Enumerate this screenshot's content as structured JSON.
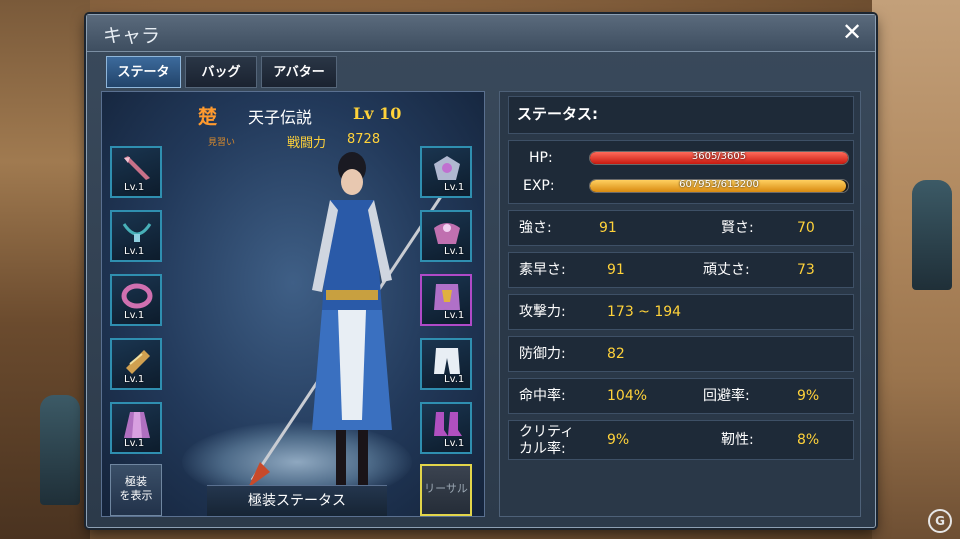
{
  "window": {
    "title": "キャラ",
    "close_label": "✕"
  },
  "tabs": [
    {
      "label": "ステータス",
      "active": true
    },
    {
      "label": "バッグ",
      "active": false
    },
    {
      "label": "アバター",
      "active": false
    }
  ],
  "character": {
    "faction": "楚",
    "name": "天子伝説",
    "level": "Lv 10",
    "subtitle": "見習い",
    "power_label": "戦闘力",
    "power_value": "8728"
  },
  "equipment": {
    "left": [
      {
        "slot": "weapon",
        "level": "Lv.1",
        "icon": "dagger-icon",
        "color": "#c87088"
      },
      {
        "slot": "necklace",
        "level": "Lv.1",
        "icon": "necklace-icon",
        "color": "#48b0b8"
      },
      {
        "slot": "ring",
        "level": "Lv.1",
        "icon": "ring-icon",
        "color": "#d070b0"
      },
      {
        "slot": "bracer",
        "level": "Lv.1",
        "icon": "bracer-icon",
        "color": "#d0a050"
      },
      {
        "slot": "cloak",
        "level": "Lv.1",
        "icon": "cloak-icon",
        "color": "#b070c0"
      }
    ],
    "right": [
      {
        "slot": "helmet",
        "level": "Lv.1",
        "icon": "helmet-icon",
        "color": "#b0b8d0"
      },
      {
        "slot": "shoulder",
        "level": "Lv.1",
        "icon": "shoulder-armor-icon",
        "color": "#c070b0"
      },
      {
        "slot": "armor",
        "level": "Lv.1",
        "icon": "chest-armor-icon",
        "color": "#b070c8"
      },
      {
        "slot": "pants",
        "level": "Lv.1",
        "icon": "pants-icon",
        "color": "#e8eef4"
      },
      {
        "slot": "boots",
        "level": "Lv.1",
        "icon": "boots-icon",
        "color": "#b050c0"
      }
    ],
    "show_equip_label": "極装\nを表示",
    "rehearsal_label": "リーサル",
    "equip_status_label": "極装ステータス"
  },
  "status": {
    "title": "ステータス:",
    "hp_label": "HP:",
    "hp_text": "3605/3605",
    "hp_fraction": 1.0,
    "exp_label": "EXP:",
    "exp_text": "607953/613200",
    "exp_fraction": 0.9914,
    "strength_label": "強さ:",
    "strength_value": "91",
    "wisdom_label": "賢さ:",
    "wisdom_value": "70",
    "agility_label": "素早さ:",
    "agility_value": "91",
    "toughness_label": "頑丈さ:",
    "toughness_value": "73",
    "attack_label": "攻撃力:",
    "attack_value": "173 ~ 194",
    "defense_label": "防御力:",
    "defense_value": "82",
    "accuracy_label": "命中率:",
    "accuracy_value": "104%",
    "evasion_label": "回避率:",
    "evasion_value": "9%",
    "critical_label": "クリティ\nカル率:",
    "critical_value": "9%",
    "resilience_label": "靭性:",
    "resilience_value": "8%"
  },
  "colors": {
    "accent_gold": "#ffd23a",
    "hp_red": "#c81a10",
    "exp_orange": "#d88a10",
    "faction_orange": "#ff9a2e"
  }
}
